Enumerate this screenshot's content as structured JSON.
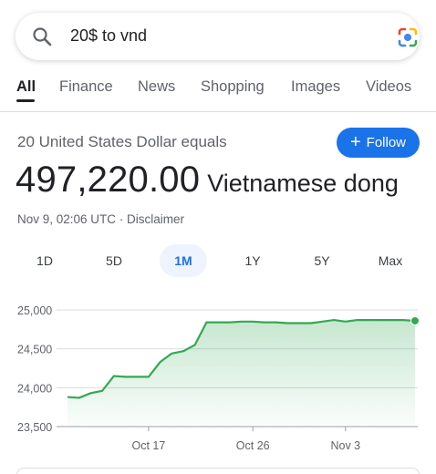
{
  "search": {
    "query": "20$ to vnd"
  },
  "tabs": [
    {
      "label": "All",
      "active": true
    },
    {
      "label": "Finance",
      "active": false
    },
    {
      "label": "News",
      "active": false
    },
    {
      "label": "Shopping",
      "active": false
    },
    {
      "label": "Images",
      "active": false
    },
    {
      "label": "Videos",
      "active": false
    }
  ],
  "converter": {
    "from_text": "20 United States Dollar equals",
    "result_value": "497,220.00",
    "result_unit": "Vietnamese dong",
    "timestamp": "Nov 9, 02:06 UTC",
    "separator": " · ",
    "disclaimer": "Disclaimer",
    "follow_label": "Follow"
  },
  "range_tabs": [
    {
      "label": "1D",
      "active": false
    },
    {
      "label": "5D",
      "active": false
    },
    {
      "label": "1M",
      "active": true
    },
    {
      "label": "1Y",
      "active": false
    },
    {
      "label": "5Y",
      "active": false
    },
    {
      "label": "Max",
      "active": false
    }
  ],
  "colors": {
    "accent": "#1a73e8",
    "line": "#34a853",
    "fill": "#e6f4ea"
  },
  "chart_data": {
    "type": "area",
    "x": [
      "Oct 10",
      "Oct 11",
      "Oct 12",
      "Oct 13",
      "Oct 14",
      "Oct 15",
      "Oct 16",
      "Oct 17",
      "Oct 18",
      "Oct 19",
      "Oct 20",
      "Oct 21",
      "Oct 22",
      "Oct 23",
      "Oct 24",
      "Oct 25",
      "Oct 26",
      "Oct 27",
      "Oct 28",
      "Oct 29",
      "Oct 30",
      "Oct 31",
      "Nov 1",
      "Nov 2",
      "Nov 3",
      "Nov 4",
      "Nov 5",
      "Nov 6",
      "Nov 7",
      "Nov 8",
      "Nov 9"
    ],
    "values": [
      23880,
      23870,
      23930,
      23960,
      24150,
      24140,
      24140,
      24140,
      24330,
      24440,
      24470,
      24550,
      24840,
      24840,
      24840,
      24850,
      24850,
      24840,
      24840,
      24830,
      24830,
      24830,
      24850,
      24870,
      24850,
      24870,
      24870,
      24870,
      24870,
      24870,
      24860
    ],
    "y_ticks": [
      "25,000",
      "24,500",
      "24,000",
      "23,500"
    ],
    "y_tick_values": [
      25000,
      24500,
      24000,
      23500
    ],
    "x_ticks": [
      "Oct 17",
      "Oct 26",
      "Nov 3"
    ],
    "x_tick_indices": [
      7,
      16,
      24
    ],
    "ylim": [
      23500,
      25000
    ],
    "grid": true
  }
}
